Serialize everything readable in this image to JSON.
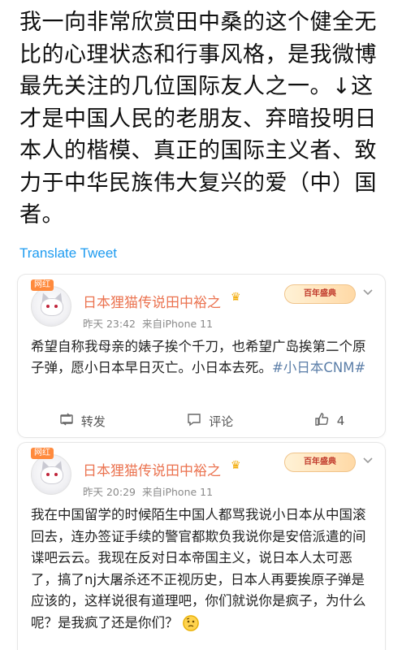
{
  "tweet": {
    "text": "我一向非常欣赏田中桑的这个健全无比的心理状态和行事风格，是我微博最先关注的几位国际友人之一。↓这才是中国人民的老朋友、弃暗投明日本人的楷模、真正的国际主义者、致力于中华民族伟大复兴的爱（中）国者。",
    "translate_label": "Translate Tweet"
  },
  "posts": [
    {
      "badge": "网红",
      "username": "日本狸猫传说田中裕之",
      "time": "昨天 23:42",
      "source": "来自iPhone 11",
      "bai_badge": "百年盛典",
      "body": "希望自称我母亲的婊子挨个千刀，也希望广岛挨第二个原子弹，愿小日本早日灭亡。小日本去死。",
      "hashtag": "#小日本CNM#",
      "actions": {
        "repost_label": "转发",
        "comment_label": "评论",
        "like_count": "4"
      }
    },
    {
      "badge": "网红",
      "username": "日本狸猫传说田中裕之",
      "time": "昨天 20:29",
      "source": "来自iPhone 11",
      "bai_badge": "百年盛典",
      "body": "我在中国留学的时候陌生中国人都骂我说小日本从中国滚回去，连办签证手续的警官都欺负我说你是安倍派遣的间谍吧云云。我现在反对日本帝国主义，说日本人太可恶了，搞了nj大屠杀还不正视历史，日本人再要挨原子弹是应该的，这样说很有道理吧，你们就说你是疯子，为什么呢？是我疯了还是你们？"
    }
  ],
  "colors": {
    "link": "#1d9bf0",
    "username": "#eb7350",
    "hashtag": "#5b7ea8"
  },
  "icons": {
    "repost": "repost-icon",
    "comment": "comment-icon",
    "like": "thumbs-up-icon"
  }
}
